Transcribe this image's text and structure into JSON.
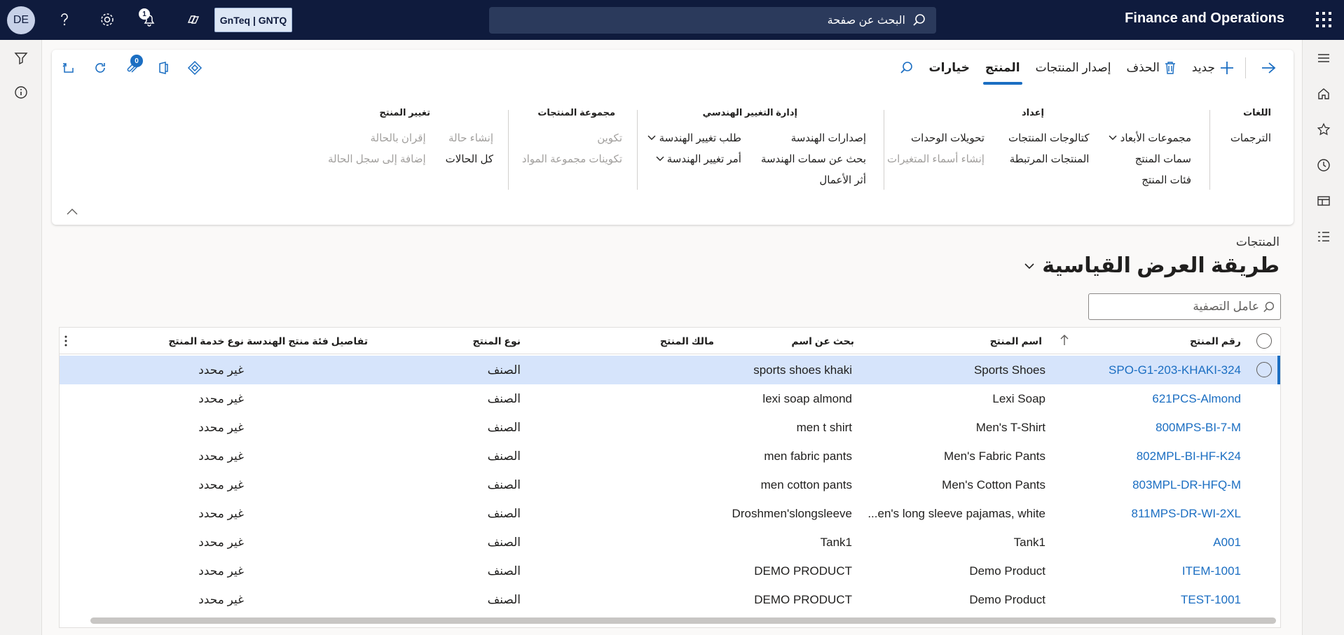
{
  "topbar": {
    "avatar_initials": "DE",
    "help_icon": "question-icon",
    "notifications_count": "1",
    "company_label": "GnTeq | GNTQ",
    "search_placeholder": "البحث عن صفحة",
    "app_title": "Finance and Operations"
  },
  "ribbon": {
    "tabs": {
      "new": "جديد",
      "delete": "الحذف",
      "release": "إصدار المنتجات",
      "product": "المنتج",
      "options": "خيارات"
    },
    "attachments_count": "0",
    "groups": {
      "languages": {
        "title": "اللغات",
        "items": [
          "الترجمات"
        ]
      },
      "setup": {
        "title": "إعداد",
        "col1": [
          "مجموعات الأبعاد",
          "سمات المنتج",
          "فئات المنتج"
        ],
        "col2": [
          "كتالوجات المنتجات",
          "المنتجات المرتبطة"
        ],
        "col3": [
          "تحويلات الوحدات",
          "إنشاء أسماء المتغيرات"
        ]
      },
      "engineering": {
        "title": "إدارة التغيير الهندسي",
        "col1": [
          "إصدارات الهندسة",
          "بحث عن سمات الهندسة",
          "أثر الأعمال"
        ],
        "col2": [
          "طلب تغيير الهندسة",
          "أمر تغيير الهندسة"
        ]
      },
      "product_group": {
        "title": "مجموعة المنتجات",
        "items": [
          "تكوين",
          "تكوينات مجموعة المواد"
        ]
      },
      "product_change": {
        "title": "تغيير المنتج",
        "col1": [
          "إنشاء حالة",
          "كل الحالات"
        ],
        "col2": [
          "إقران بالحالة",
          "إضافة إلى سجل الحالة"
        ]
      }
    }
  },
  "page": {
    "subtitle": "المنتجات",
    "view_title": "طريقة العرض القياسية",
    "filter_placeholder": "عامل التصفية"
  },
  "grid": {
    "columns": {
      "product_number": "رقم المنتج",
      "product_name": "اسم المنتج",
      "search_name": "بحث عن اسم",
      "product_owner": "مالك المنتج",
      "product_type": "نوع المنتج",
      "eng_category": "تفاصيل فئة منتج الهندسة",
      "service_type": "نوع خدمة المنتج"
    },
    "rows": [
      {
        "number": "SPO-G1-203-KHAKI-324",
        "name": "Sports Shoes",
        "search": "sports shoes khaki",
        "owner": "",
        "type": "الصنف",
        "eng": "",
        "service": "غير محدد"
      },
      {
        "number": "621PCS-Almond",
        "name": "Lexi Soap",
        "search": "lexi soap almond",
        "owner": "",
        "type": "الصنف",
        "eng": "",
        "service": "غير محدد"
      },
      {
        "number": "800MPS-BI-7-M",
        "name": "Men's T-Shirt",
        "search": "men t shirt",
        "owner": "",
        "type": "الصنف",
        "eng": "",
        "service": "غير محدد"
      },
      {
        "number": "802MPL-BI-HF-K24",
        "name": "Men's Fabric Pants",
        "search": "men fabric pants",
        "owner": "",
        "type": "الصنف",
        "eng": "",
        "service": "غير محدد"
      },
      {
        "number": "803MPL-DR-HFQ-M",
        "name": "Men's Cotton Pants",
        "search": "men cotton pants",
        "owner": "",
        "type": "الصنف",
        "eng": "",
        "service": "غير محدد"
      },
      {
        "number": "811MPS-DR-WI-2XL",
        "name": "...en's long sleeve pajamas, white",
        "search": "Droshmen'slongsleeve",
        "owner": "",
        "type": "الصنف",
        "eng": "",
        "service": "غير محدد"
      },
      {
        "number": "A001",
        "name": "Tank1",
        "search": "Tank1",
        "owner": "",
        "type": "الصنف",
        "eng": "",
        "service": "غير محدد"
      },
      {
        "number": "ITEM-1001",
        "name": "Demo Product",
        "search": "DEMO PRODUCT",
        "owner": "",
        "type": "الصنف",
        "eng": "",
        "service": "غير محدد"
      },
      {
        "number": "TEST-1001",
        "name": "Demo Product",
        "search": "DEMO PRODUCT",
        "owner": "",
        "type": "الصنف",
        "eng": "",
        "service": "غير محدد"
      }
    ]
  }
}
